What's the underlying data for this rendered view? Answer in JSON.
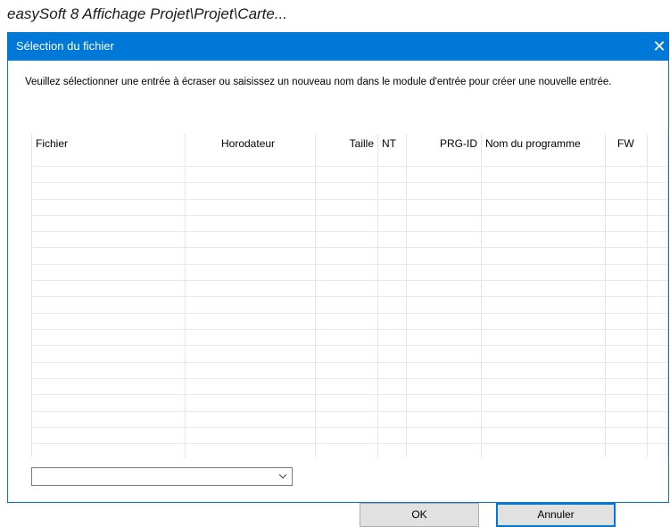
{
  "caption": "easySoft 8 Affichage Projet\\Projet\\Carte...",
  "dialog": {
    "title": "Sélection du fichier",
    "close_glyph": "✕",
    "instruction": "Veuillez sélectionner une entrée à écraser ou saisissez un nouveau nom dans le module d'entrée pour créer une nouvelle entrée.",
    "columns": [
      "Fichier",
      "Horodateur",
      "Taille",
      "NT",
      "PRG-ID",
      "Nom du programme",
      "FW"
    ],
    "filename_value": "",
    "ok_label": "OK",
    "cancel_label": "Annuler"
  },
  "icons": {
    "close": "close-icon",
    "dropdown": "chevron-down-icon"
  },
  "colors": {
    "titlebar": "#0078d7",
    "button_face": "#e1e1e1",
    "focus_border": "#0078d7"
  }
}
